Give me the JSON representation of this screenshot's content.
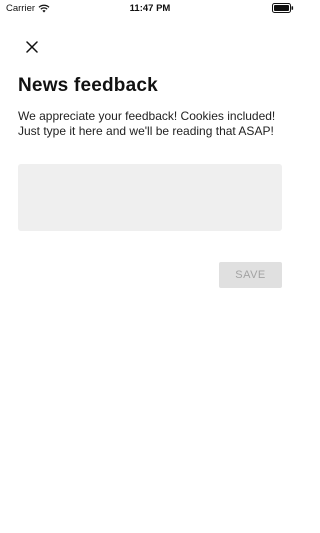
{
  "status_bar": {
    "carrier": "Carrier",
    "time": "11:47 PM",
    "icons": [
      "wifi-icon",
      "battery-icon"
    ]
  },
  "header": {
    "close_icon": "close-icon"
  },
  "content": {
    "title": "News feedback",
    "description": "We appreciate your feedback! Cookies included! Just type it here and we'll be reading that ASAP!",
    "feedback_input_value": "",
    "save_label": "SAVE",
    "save_enabled": false
  },
  "colors": {
    "background": "#ffffff",
    "input_background": "#efefef",
    "button_background": "#e0e0e0",
    "button_text": "#a3a3a3",
    "text": "#111111"
  }
}
